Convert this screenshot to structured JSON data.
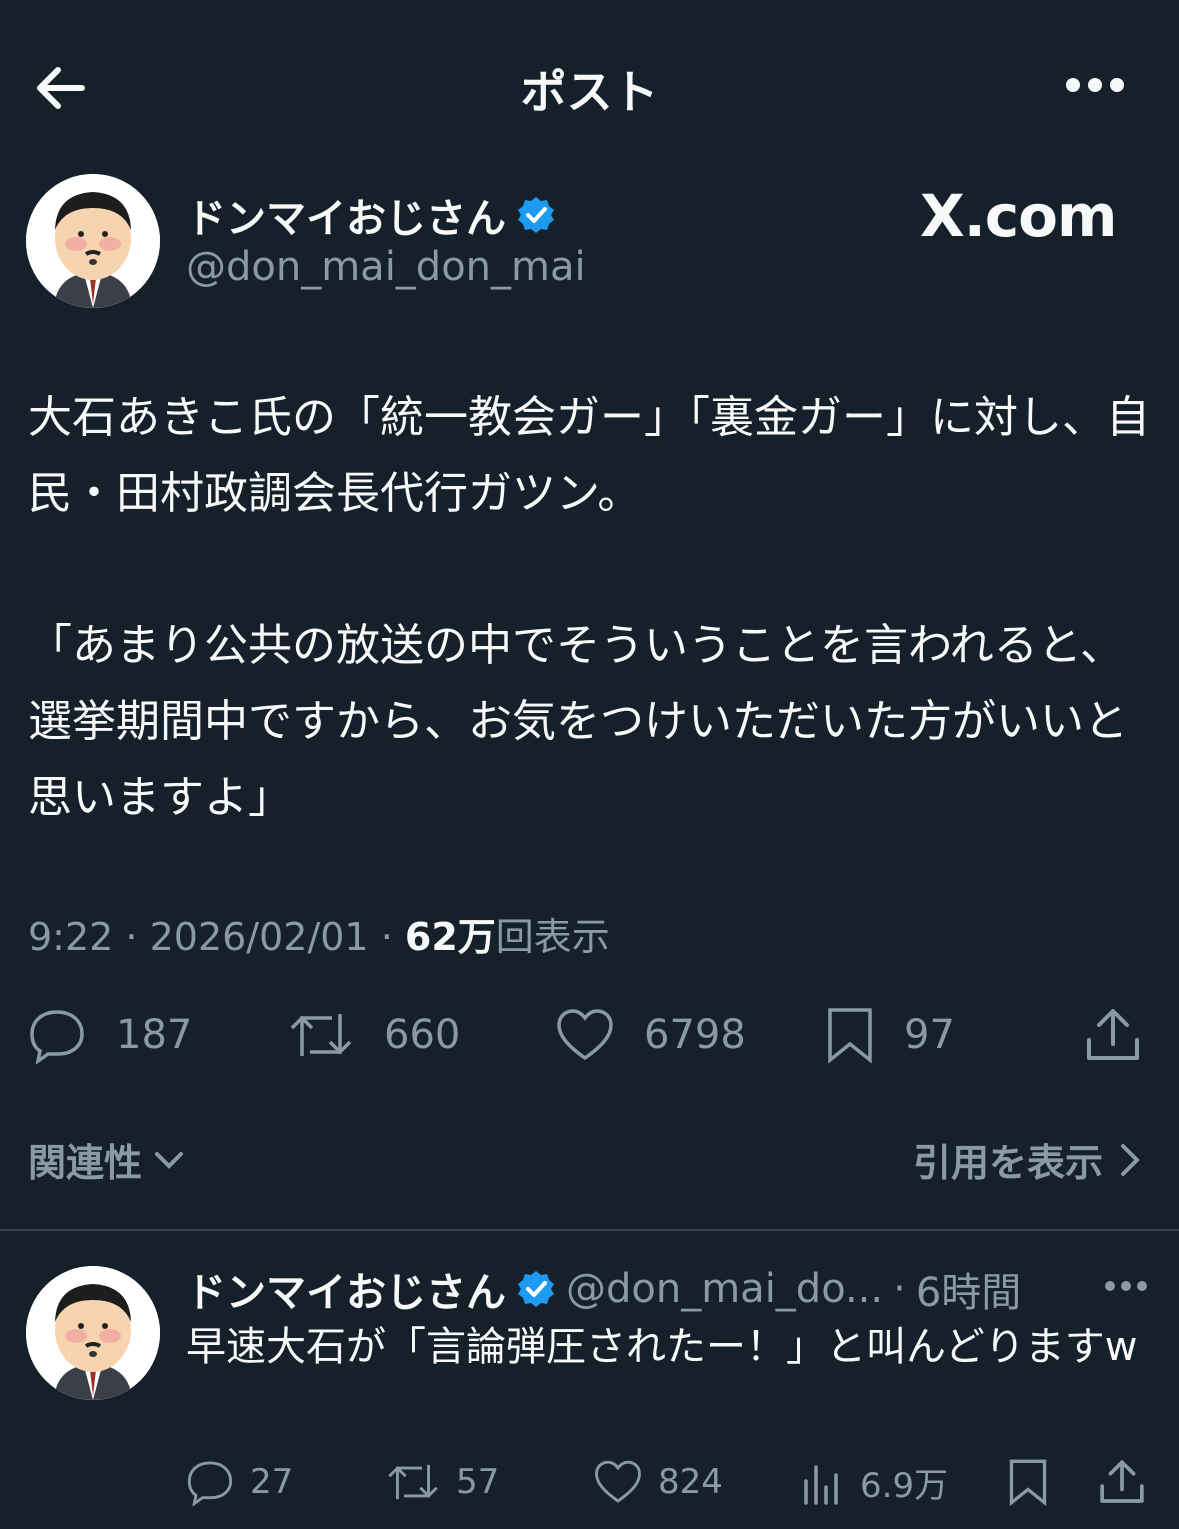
{
  "header": {
    "title": "ポスト"
  },
  "author": {
    "name": "ドンマイおじさん",
    "handle": "@don_mai_don_mai",
    "watermark": "X.com"
  },
  "tweet": {
    "text": "大石あきこ氏の「統一教会ガー」「裏金ガー」に対し、自民・田村政調会長代行ガツン。\n\n「あまり公共の放送の中でそういうことを言われると、選挙期間中ですから、お気をつけいただいた方がいいと思いますよ」",
    "time": "9:22",
    "date": "2026/02/01",
    "views_count": "62万",
    "views_label": "回表示",
    "stats": {
      "replies": "187",
      "reposts": "660",
      "likes": "6798",
      "bookmarks": "97"
    }
  },
  "related": {
    "label": "関連性",
    "quotes_label": "引用を表示"
  },
  "reply": {
    "name": "ドンマイおじさん",
    "handle": "@don_mai_do...",
    "time": "6時間",
    "text": "早速大石が「言論弾圧されたー！」と叫んどりますw",
    "stats": {
      "replies": "27",
      "reposts": "57",
      "likes": "824",
      "views": "6.9万"
    }
  },
  "colors": {
    "background": "#15202b",
    "muted": "#8b98a5",
    "verified": "#1d9bf0",
    "divider": "#38444d"
  }
}
